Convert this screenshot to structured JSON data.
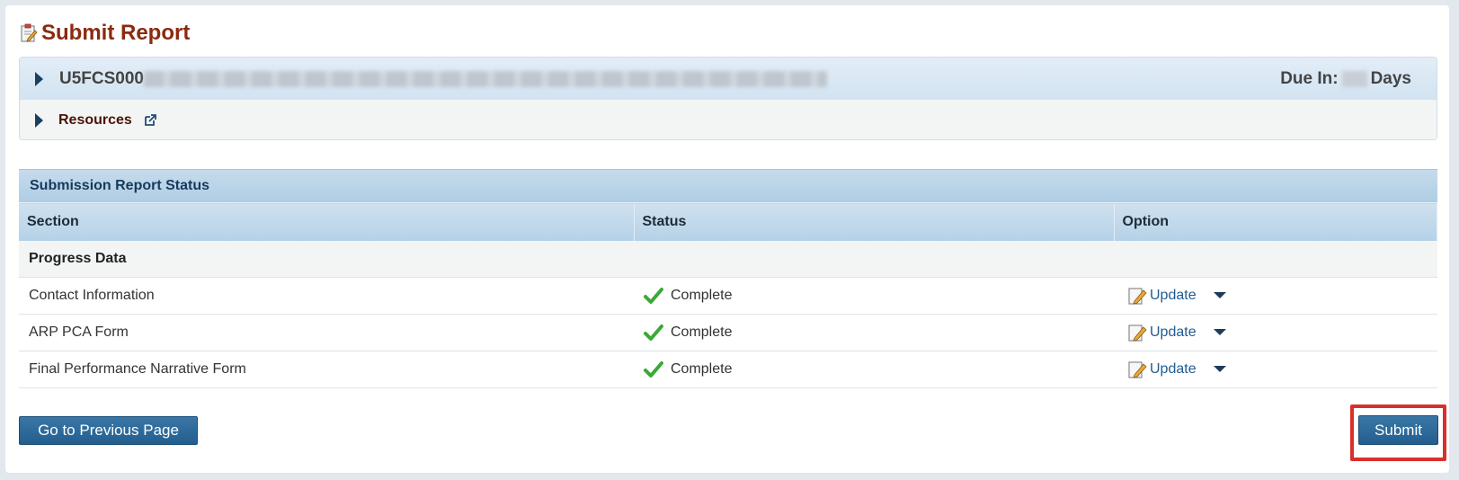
{
  "page": {
    "title": "Submit Report"
  },
  "grant": {
    "id_prefix": "U5FCS000",
    "due_label": "Due In:",
    "due_suffix": "Days",
    "resources_label": "Resources"
  },
  "status_panel": {
    "title": "Submission Report Status",
    "columns": [
      "Section",
      "Status",
      "Option"
    ],
    "group_label": "Progress Data",
    "rows": [
      {
        "section": "Contact Information",
        "status": "Complete",
        "option": "Update"
      },
      {
        "section": "ARP PCA Form",
        "status": "Complete",
        "option": "Update"
      },
      {
        "section": "Final Performance Narrative Form",
        "status": "Complete",
        "option": "Update"
      }
    ]
  },
  "buttons": {
    "previous": "Go to Previous Page",
    "submit": "Submit"
  },
  "colors": {
    "title": "#8b2a10",
    "accent": "#235e8e",
    "highlight": "#d9302b",
    "check": "#3aa935"
  },
  "icons": {
    "title": "report-edit-icon",
    "expand": "triangle-right-icon",
    "external": "external-link-icon",
    "status": "check-icon",
    "update": "edit-pencil-icon",
    "dropdown": "caret-down-icon"
  }
}
